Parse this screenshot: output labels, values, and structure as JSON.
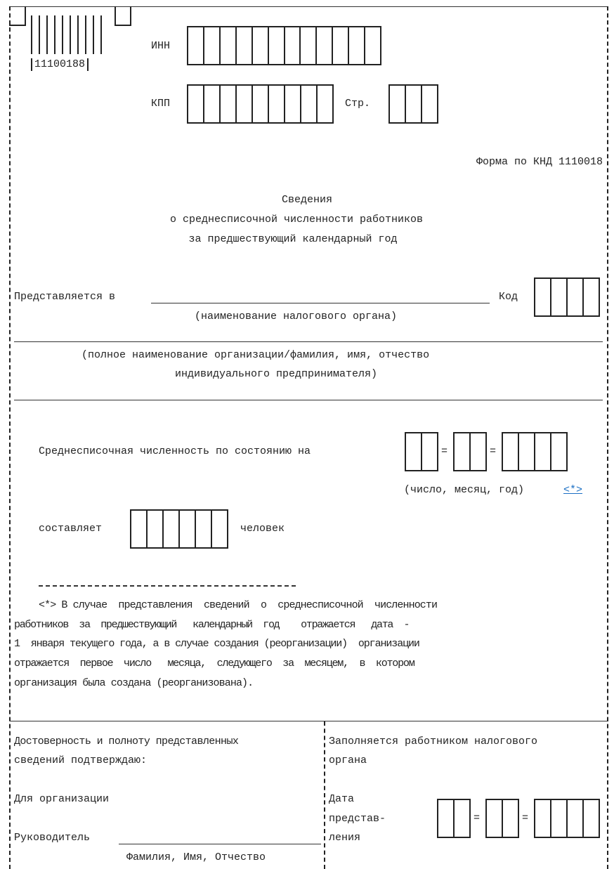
{
  "header": {
    "barcode_number": "11100188",
    "inn_label": "ИНН",
    "kpp_label": "КПП",
    "page_label": "Стр.",
    "form_code": "Форма по КНД 1110018"
  },
  "title": {
    "line1": "Сведения",
    "line2": "о среднесписочной численности работников",
    "line3": "за предшествующий календарный год"
  },
  "submission": {
    "submitted_to_label": "Представляется в",
    "code_label": "Код",
    "tax_authority_hint": "(наименование налогового органа)",
    "org_name_hint_line1": "(полное наименование организации/фамилия, имя, отчество",
    "org_name_hint_line2": "индивидуального предпринимателя)"
  },
  "headcount": {
    "as_of_label": "Среднесписочная численность по состоянию на",
    "date_hint": "(число, месяц, год)",
    "footnote_link": "<*>",
    "amounts_to_label": "составляет",
    "people_label": "человек",
    "date_separator": "="
  },
  "footnote": {
    "separator": "--------------------------------",
    "line1": "<*> В случае  представления  сведений  о  среднесписочной  численности",
    "line2": "работников  за  предшествующий   календарный  год    отражается   дата  -",
    "line3": "1  января текущего года, а в случае создания (реорганизации)  организации",
    "line4": "отражается  первое  число   месяца,  следующего  за  месяцем,  в  котором",
    "line5": "организация была создана (реорганизована)."
  },
  "footer_left": {
    "confirm_line1": "Достоверность и полноту представленных",
    "confirm_line2": "сведений подтверждаю:",
    "for_org": "Для организации",
    "head_label": "Руководитель",
    "name_hint": "Фамилия, Имя, Отчество"
  },
  "footer_right": {
    "filled_by_line1": "Заполняется работником налогового",
    "filled_by_line2": "органа",
    "date_line1": "Дата",
    "date_line2": "представ-",
    "date_line3": "ления"
  }
}
